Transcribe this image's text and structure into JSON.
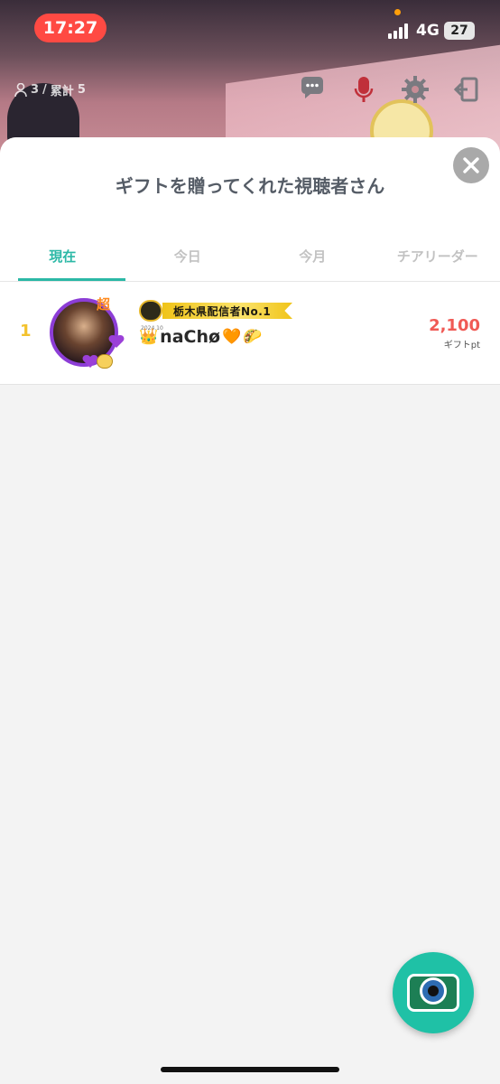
{
  "status_bar": {
    "time": "17:27",
    "network": "4G",
    "battery": "27"
  },
  "stream": {
    "viewers": "3",
    "total_label": "累計",
    "total": "5"
  },
  "sheet": {
    "title": "ギフトを贈ってくれた視聴者さん",
    "tabs": [
      {
        "label": "現在",
        "active": true
      },
      {
        "label": "今日",
        "active": false
      },
      {
        "label": "今月",
        "active": false
      },
      {
        "label": "チアリーダー",
        "active": false
      }
    ],
    "ranking": [
      {
        "rank": "1",
        "badge": "超",
        "title_banner": "栃木県配信者No.1",
        "banner_date": "2024.10",
        "username": "naChø",
        "gift_points": "2,100",
        "gift_unit": "ギフトpt"
      }
    ]
  },
  "colors": {
    "accent": "#2bb8a6",
    "points": "#f05a55",
    "rank": "#f3c22d",
    "time_pill": "#ff4a43"
  }
}
